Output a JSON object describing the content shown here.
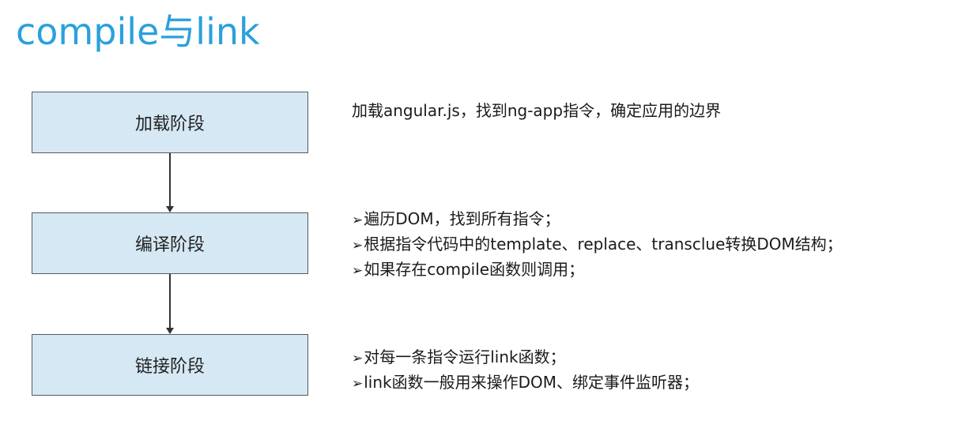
{
  "title": "compile与link",
  "stages": [
    {
      "label": "加载阶段",
      "lines": [
        "加载angular.js，找到ng-app指令，确定应用的边界"
      ],
      "bulleted": false
    },
    {
      "label": "编译阶段",
      "lines": [
        "遍历DOM，找到所有指令；",
        "根据指令代码中的template、replace、transclue转换DOM结构；",
        "如果存在compile函数则调用；"
      ],
      "bulleted": true
    },
    {
      "label": "链接阶段",
      "lines": [
        "对每一条指令运行link函数；",
        "link函数一般用来操作DOM、绑定事件监听器；"
      ],
      "bulleted": true
    }
  ],
  "bullet_symbol": "➢",
  "colors": {
    "title": "#2aa0dc",
    "box_fill": "#d5e8f4",
    "box_border": "#555b60"
  }
}
